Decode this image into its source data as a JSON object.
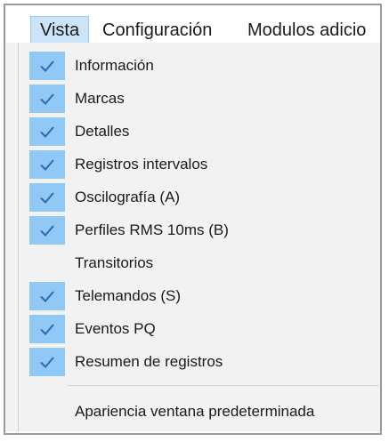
{
  "menubar": {
    "items": [
      {
        "label": "Vista",
        "active": true
      },
      {
        "label": "Configuración",
        "active": false
      },
      {
        "label": "Modulos adicio",
        "active": false
      }
    ]
  },
  "menu": {
    "items": [
      {
        "label": "Información",
        "checked": true,
        "icon": "checkmark-icon"
      },
      {
        "label": "Marcas",
        "checked": true,
        "icon": "checkmark-icon"
      },
      {
        "label": "Detalles",
        "checked": true,
        "icon": "checkmark-icon"
      },
      {
        "label": "Registros intervalos",
        "checked": true,
        "icon": "checkmark-icon"
      },
      {
        "label": "Oscilografía (A)",
        "checked": true,
        "icon": "checkmark-icon"
      },
      {
        "label": "Perfiles RMS 10ms (B)",
        "checked": true,
        "icon": "checkmark-icon"
      },
      {
        "label": "Transitorios",
        "checked": false,
        "icon": ""
      },
      {
        "label": "Telemandos (S)",
        "checked": true,
        "icon": "checkmark-icon"
      },
      {
        "label": "Eventos PQ",
        "checked": true,
        "icon": "checkmark-icon"
      },
      {
        "label": "Resumen de registros",
        "checked": true,
        "icon": "checkmark-icon"
      }
    ],
    "footer_item": {
      "label": "Apariencia ventana predeterminada"
    }
  },
  "colors": {
    "check_bg": "#90c8f6",
    "menu_bg": "#f2f2f2",
    "active_menubar_bg": "#cce4f7",
    "checkmark": "#2b6cb0"
  }
}
